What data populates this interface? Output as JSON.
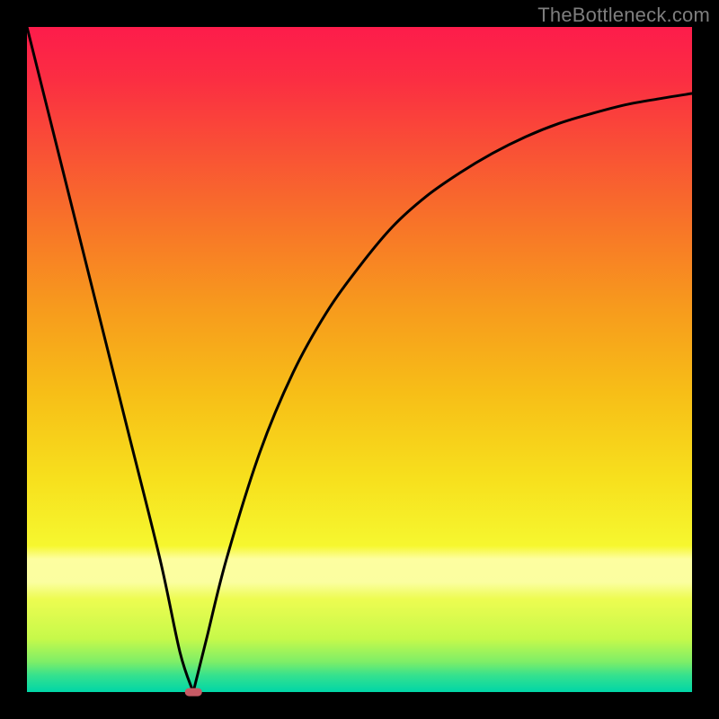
{
  "source_label": "TheBottleneck.com",
  "chart_data": {
    "type": "line",
    "title": "",
    "xlabel": "",
    "ylabel": "",
    "xlim": [
      0,
      100
    ],
    "ylim": [
      0,
      100
    ],
    "grid": false,
    "background": "rainbow-gradient-red-to-green",
    "series": [
      {
        "name": "curve-left",
        "x": [
          0,
          5,
          10,
          15,
          20,
          23,
          25
        ],
        "values": [
          100,
          80,
          60,
          40,
          20,
          6,
          0
        ]
      },
      {
        "name": "curve-right",
        "x": [
          25,
          27,
          30,
          35,
          40,
          45,
          50,
          55,
          60,
          65,
          70,
          75,
          80,
          85,
          90,
          95,
          100
        ],
        "values": [
          0,
          8,
          20,
          36,
          48,
          57,
          64,
          70,
          74.5,
          78,
          81,
          83.5,
          85.5,
          87,
          88.3,
          89.2,
          90
        ]
      }
    ],
    "marker": {
      "name": "optimal-point",
      "x": 25,
      "y": 0,
      "color": "#c75a65",
      "width_frac": 0.025,
      "height_frac": 0.012
    },
    "gradient_stops": [
      {
        "pos": 0.0,
        "color": "#fd1c4b"
      },
      {
        "pos": 0.08,
        "color": "#fb2e42"
      },
      {
        "pos": 0.18,
        "color": "#f94f36"
      },
      {
        "pos": 0.3,
        "color": "#f87528"
      },
      {
        "pos": 0.42,
        "color": "#f79a1d"
      },
      {
        "pos": 0.55,
        "color": "#f7be17"
      },
      {
        "pos": 0.68,
        "color": "#f7e01d"
      },
      {
        "pos": 0.78,
        "color": "#f6f72f"
      },
      {
        "pos": 0.8,
        "color": "#fdfea0"
      },
      {
        "pos": 0.835,
        "color": "#fbfea0"
      },
      {
        "pos": 0.86,
        "color": "#edfc51"
      },
      {
        "pos": 0.92,
        "color": "#c6f94a"
      },
      {
        "pos": 0.955,
        "color": "#7dee68"
      },
      {
        "pos": 0.975,
        "color": "#35e18e"
      },
      {
        "pos": 1.0,
        "color": "#00d6a7"
      }
    ]
  }
}
